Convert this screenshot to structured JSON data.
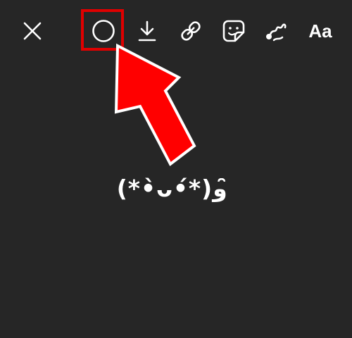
{
  "toolbar": {
    "icons": {
      "close": "close-icon",
      "circle": "circle-icon",
      "download": "download-icon",
      "link": "link-icon",
      "sticker": "sticker-icon",
      "draw": "draw-icon"
    },
    "text_label": "Aa"
  },
  "canvas": {
    "text": "(*•̀ᴗ•́*)و ̑̑"
  },
  "annotation": {
    "highlight_color": "#e00000",
    "arrow_color": "#ff0000"
  }
}
